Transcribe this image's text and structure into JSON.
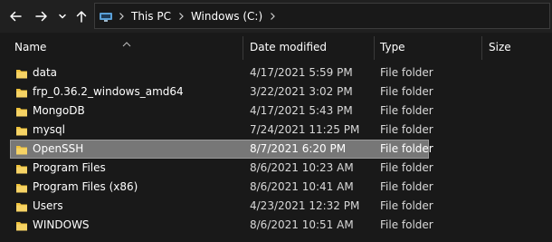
{
  "nav": {
    "back_icon": "back-arrow-icon",
    "forward_icon": "forward-arrow-icon",
    "recent_icon": "chevron-down-icon",
    "up_icon": "up-arrow-icon"
  },
  "address": {
    "icon": "this-pc-icon",
    "breadcrumbs": [
      "This PC",
      "Windows (C:)"
    ]
  },
  "columns": {
    "name": "Name",
    "date": "Date modified",
    "type": "Type",
    "size": "Size"
  },
  "files": [
    {
      "name": "data",
      "date": "4/17/2021 5:59 PM",
      "type": "File folder",
      "size": ""
    },
    {
      "name": "frp_0.36.2_windows_amd64",
      "date": "3/22/2021 3:02 PM",
      "type": "File folder",
      "size": ""
    },
    {
      "name": "MongoDB",
      "date": "4/17/2021 5:43 PM",
      "type": "File folder",
      "size": ""
    },
    {
      "name": "mysql",
      "date": "7/24/2021 11:25 PM",
      "type": "File folder",
      "size": ""
    },
    {
      "name": "OpenSSH",
      "date": "8/7/2021 6:20 PM",
      "type": "File folder",
      "size": ""
    },
    {
      "name": "Program Files",
      "date": "8/6/2021 10:23 AM",
      "type": "File folder",
      "size": ""
    },
    {
      "name": "Program Files (x86)",
      "date": "8/6/2021 10:41 AM",
      "type": "File folder",
      "size": ""
    },
    {
      "name": "Users",
      "date": "4/23/2021 12:32 PM",
      "type": "File folder",
      "size": ""
    },
    {
      "name": "WINDOWS",
      "date": "8/6/2021 10:51 AM",
      "type": "File folder",
      "size": ""
    }
  ],
  "selected_index": 4,
  "colors": {
    "background": "#191919",
    "selection": "#777777",
    "folder": "#f0c33c"
  }
}
